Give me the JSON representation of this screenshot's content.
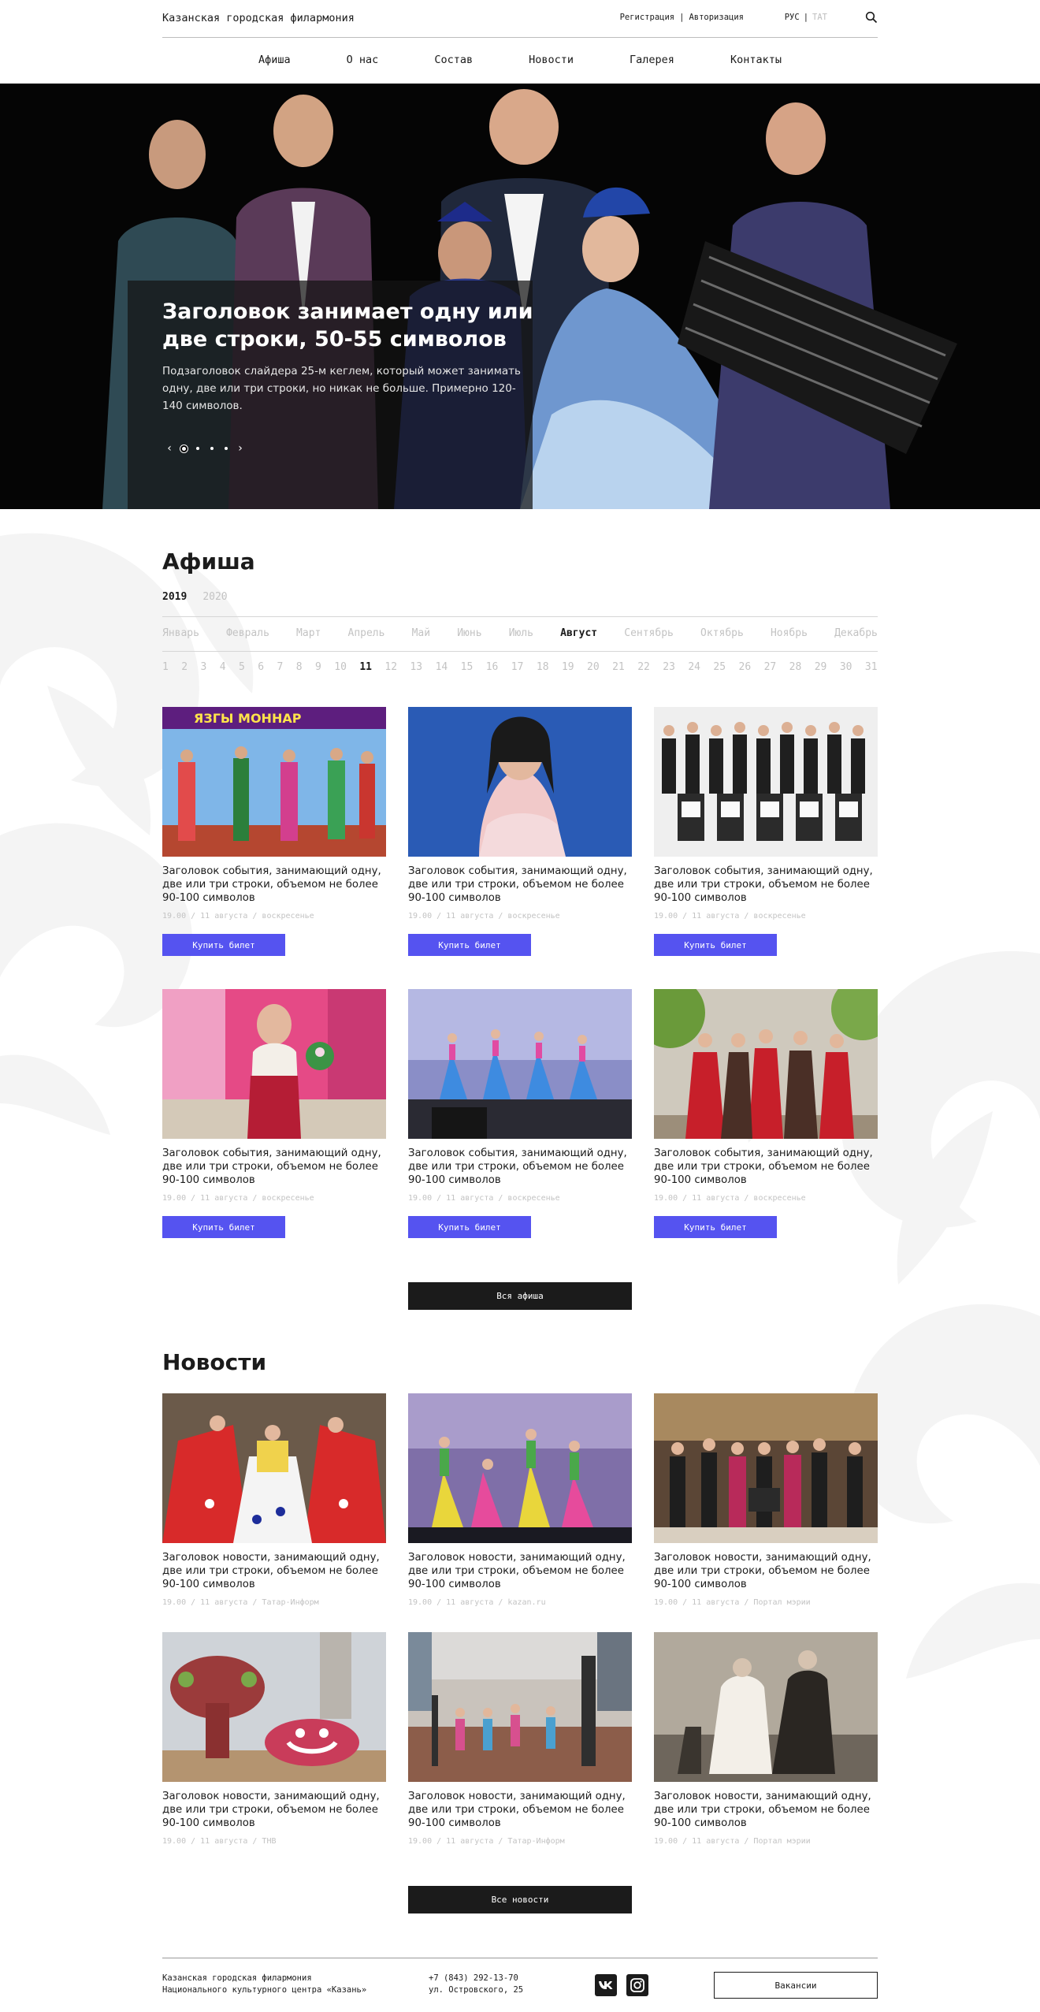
{
  "header": {
    "brand": "Казанская городская филармония",
    "register": "Регистрация",
    "auth_separator": "|",
    "login": "Авторизация",
    "lang_active": "РУС",
    "lang_separator": "|",
    "lang_inactive": "TAT",
    "search_icon": "search-icon"
  },
  "nav": [
    "Афиша",
    "О нас",
    "Состав",
    "Новости",
    "Галерея",
    "Контакты"
  ],
  "hero": {
    "title": "Заголовок занимает одну или две строки, 50-55 символов",
    "subtitle": "Подзаголовок слайдера 25-м кеглем, который может занимать одну, две или три строки, но никак не больше. Примерно 120-140 символов.",
    "prev": "‹",
    "next": "›",
    "slides_total": 4,
    "slide_active": 1
  },
  "afisha": {
    "title": "Афиша",
    "years": [
      "2019",
      "2020"
    ],
    "active_year": "2019",
    "months": [
      "Январь",
      "Февраль",
      "Март",
      "Апрель",
      "Май",
      "Июнь",
      "Июль",
      "Август",
      "Сентябрь",
      "Октябрь",
      "Ноябрь",
      "Декабрь"
    ],
    "active_month": "Август",
    "days": [
      "1",
      "2",
      "3",
      "4",
      "5",
      "6",
      "7",
      "8",
      "9",
      "10",
      "11",
      "12",
      "13",
      "14",
      "15",
      "16",
      "17",
      "18",
      "19",
      "20",
      "21",
      "22",
      "23",
      "24",
      "25",
      "26",
      "27",
      "28",
      "29",
      "30",
      "31"
    ],
    "active_day": "11",
    "events": [
      {
        "title": "Заголовок события, занимающий одну, две или три строки, объемом не более 90-100 символов",
        "meta": "19.00 / 11 августа / воскресенье",
        "button": "Купить билет"
      },
      {
        "title": "Заголовок события, занимающий одну, две или три строки, объемом не более 90-100 символов",
        "meta": "19.00 / 11 августа / воскресенье",
        "button": "Купить билет"
      },
      {
        "title": "Заголовок события, занимающий одну, две или три строки, объемом не более 90-100 символов",
        "meta": "19.00 / 11 августа / воскресенье",
        "button": "Купить билет"
      },
      {
        "title": "Заголовок события, занимающий одну, две или три строки, объемом не более 90-100 символов",
        "meta": "19.00 / 11 августа / воскресенье",
        "button": "Купить билет"
      },
      {
        "title": "Заголовок события, занимающий одну, две или три строки, объемом не более 90-100 символов",
        "meta": "19.00 / 11 августа / воскресенье",
        "button": "Купить билет"
      },
      {
        "title": "Заголовок события, занимающий одну, две или три строки, объемом не более 90-100 символов",
        "meta": "19.00 / 11 августа / воскресенье",
        "button": "Купить билет"
      }
    ],
    "all_button": "Вся афиша"
  },
  "news": {
    "title": "Новости",
    "items": [
      {
        "title": "Заголовок новости, занимающий одну, две или три строки, объемом не более 90-100 символов",
        "meta": "19.00 / 11 августа / Татар-Информ"
      },
      {
        "title": "Заголовок новости, занимающий одну, две или три строки, объемом не более 90-100 символов",
        "meta": "19.00 / 11 августа / kazan.ru"
      },
      {
        "title": "Заголовок новости, занимающий одну, две или три строки, объемом не более 90-100 символов",
        "meta": "19.00 / 11 августа / Портал мэрии"
      },
      {
        "title": "Заголовок новости, занимающий одну, две или три строки, объемом не более 90-100 символов",
        "meta": "19.00 / 11 августа / ТНВ"
      },
      {
        "title": "Заголовок новости, занимающий одну, две или три строки, объемом не более 90-100 символов",
        "meta": "19.00 / 11 августа / Татар-Информ"
      },
      {
        "title": "Заголовок новости, занимающий одну, две или три строки, объемом не более 90-100 символов",
        "meta": "19.00 / 11 августа / Портал мэрии"
      }
    ],
    "all_button": "Все новости"
  },
  "footer": {
    "org_line1": "Казанская городская филармония",
    "org_line2": "Национального культурного центра «Казань»",
    "phone": "+7 (843) 292-13-70",
    "address": "ул. Островского, 25",
    "social_icons": [
      "vk-icon",
      "instagram-icon"
    ],
    "vacancies": "Вакансии"
  },
  "colors": {
    "accent": "#5553f0",
    "dark": "#1b1b1b",
    "muted": "#c3c3c3"
  }
}
